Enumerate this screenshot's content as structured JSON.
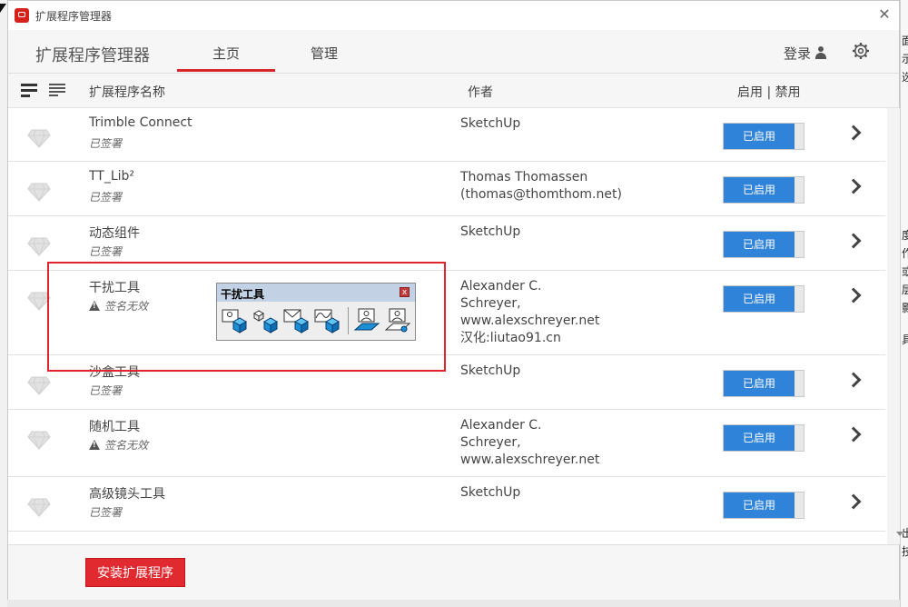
{
  "window": {
    "title": "扩展程序管理器",
    "close_icon": "close-icon"
  },
  "nav": {
    "brand": "扩展程序管理器",
    "tabs": [
      {
        "label": "主页",
        "active": true
      },
      {
        "label": "管理",
        "active": false
      }
    ],
    "login_label": "登录",
    "icons": {
      "user": "user-icon",
      "settings": "gear-icon"
    }
  },
  "columns": {
    "icons": [
      "expand-all-icon",
      "collapse-all-icon"
    ],
    "name": "扩展程序名称",
    "author": "作者",
    "status": "启用 | 禁用"
  },
  "extensions": [
    {
      "name": "Trimble Connect",
      "sign": "已签署",
      "warning": false,
      "author": [
        "SketchUp"
      ],
      "state": "已启用"
    },
    {
      "name": "TT_Lib²",
      "sign": "已签署",
      "warning": false,
      "author": [
        "Thomas Thomassen",
        "(thomas@thomthom.net)"
      ],
      "state": "已启用"
    },
    {
      "name": "动态组件",
      "sign": "已签署",
      "warning": false,
      "author": [
        "SketchUp"
      ],
      "state": "已启用"
    },
    {
      "name": "干扰工具",
      "sign": "签名无效",
      "warning": true,
      "author": [
        "Alexander C.",
        "Schreyer,",
        "www.alexschreyer.net",
        "汉化:liutao91.cn"
      ],
      "state": "已启用"
    },
    {
      "name": "沙盒工具",
      "sign": "已签署",
      "warning": false,
      "author": [
        "SketchUp"
      ],
      "state": "已启用"
    },
    {
      "name": "随机工具",
      "sign": "签名无效",
      "warning": true,
      "author": [
        "Alexander C.",
        "Schreyer,",
        "www.alexschreyer.net"
      ],
      "state": "已启用"
    },
    {
      "name": "高级镜头工具",
      "sign": "已签署",
      "warning": false,
      "author": [
        "SketchUp"
      ],
      "state": "已启用"
    }
  ],
  "footer": {
    "install_label": "安装扩展程序"
  },
  "floating_toolbar": {
    "title": "干扰工具",
    "close_label": "x",
    "buttons": [
      "interfere-image-cube-icon",
      "interfere-cubes-icon",
      "interfere-envelope-cube-icon",
      "interfere-wave-cube-icon",
      "interfere-image-plane-icon",
      "interfere-image-point-icon"
    ]
  },
  "colors": {
    "accent_red": "#d9262c",
    "toggle_blue": "#2f83d8",
    "highlight_red": "#e0262c"
  },
  "side_fragments": [
    "面",
    "示",
    "选",
    "度",
    "作",
    "或",
    "层",
    "影",
    "具",
    "出",
    "技"
  ]
}
